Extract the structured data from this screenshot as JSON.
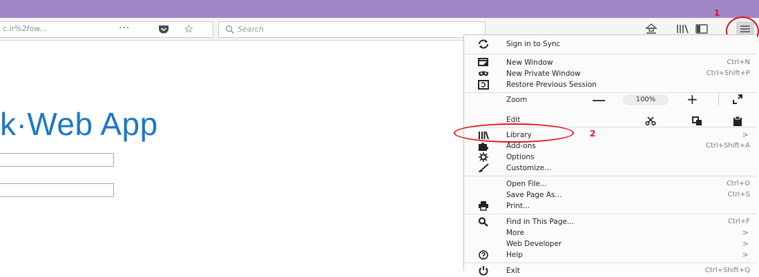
{
  "browser": {
    "url_text": "c.ir%2fow...",
    "page_actions_label": "···",
    "search_placeholder": "Search"
  },
  "annotations": {
    "num1": "1",
    "num2": "2",
    "color": "#e0101a"
  },
  "page": {
    "title": "k·Web App",
    "accent_color": "#1a78c8"
  },
  "menu": {
    "sync": "Sign in to Sync",
    "new_window": {
      "label": "New Window",
      "shortcut": "Ctrl+N"
    },
    "new_private": {
      "label": "New Private Window",
      "shortcut": "Ctrl+Shift+P"
    },
    "restore": "Restore Previous Session",
    "zoom_label": "Zoom",
    "zoom_value": "100%",
    "edit_label": "Edit",
    "library": {
      "label": "Library",
      "arrow": ">"
    },
    "addons": {
      "label": "Add-ons",
      "shortcut": "Ctrl+Shift+A"
    },
    "options": "Options",
    "customize": "Customize...",
    "open_file": {
      "label": "Open File...",
      "shortcut": "Ctrl+O"
    },
    "save_page": {
      "label": "Save Page As...",
      "shortcut": "Ctrl+S"
    },
    "print": "Print...",
    "find": {
      "label": "Find in This Page...",
      "shortcut": "Ctrl+F"
    },
    "more": {
      "label": "More",
      "arrow": ">"
    },
    "webdev": {
      "label": "Web Developer",
      "arrow": ">"
    },
    "help": {
      "label": "Help",
      "arrow": ">"
    },
    "exit": {
      "label": "Exit",
      "shortcut": "Ctrl+Shift+Q"
    }
  }
}
